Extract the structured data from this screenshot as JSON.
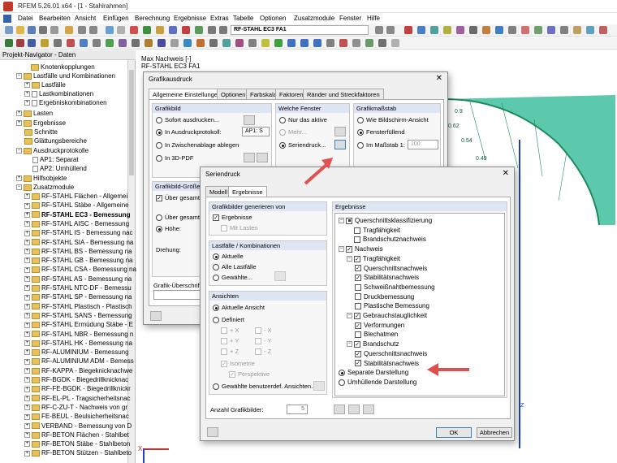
{
  "window": {
    "title": "RFEM 5.26.01 x64 - [1 - Stahlrahmen]"
  },
  "menu": [
    "Datei",
    "Bearbeiten",
    "Ansicht",
    "Einfügen",
    "Berechnung",
    "Ergebnisse",
    "Extras",
    "Tabelle",
    "Optionen",
    "Zusatzmodule",
    "Fenster",
    "Hilfe"
  ],
  "toolbar": {
    "module_combo": "RF-STAHL EC3 FA1"
  },
  "navigator": {
    "title": "Projekt-Navigator - Daten",
    "items": [
      "Knotenkopplungen",
      "Lastfälle und Kombinationen",
      "Lastfälle",
      "Lastkombinationen",
      "Ergebniskombinationen",
      "Lasten",
      "Ergebnisse",
      "Schnitte",
      "Glättungsbereiche",
      "Ausdruckprotokolle",
      "AP1: Separat",
      "AP2: Umhüllend",
      "Hilfsobjekte",
      "Zusatzmodule",
      "RF-STAHL Flächen - Allgemei",
      "RF-STAHL Stäbe - Allgemeine",
      "RF-STAHL EC3 - Bemessung",
      "RF-STAHL AISC - Bemessung",
      "RF-STAHL IS - Bemessung nac",
      "RF-STAHL SIA - Bemessung na",
      "RF-STAHL BS - Bemessung na",
      "RF-STAHL GB - Bemessung na",
      "RF-STAHL CSA - Bemessung na",
      "RF-STAHL AS - Bemessung na",
      "RF-STAHL NTC-DF - Bemessu",
      "RF-STAHL SP - Bemessung na",
      "RF-STAHL Plastisch - Plastisch",
      "RF-STAHL SANS - Bemessung",
      "RF-STAHL Ermüdung Stäbe - E",
      "RF-STAHL NBR - Bemessung n",
      "RF-STAHL HK - Bemessung na",
      "RF-ALUMINIUM - Bemessung",
      "RF-ALUMINIUM ADM - Bemess",
      "RF-KAPPA - Biegeknicknachwe",
      "RF-BGDK - Biegedrillknicknac",
      "RF-FE-BGDK - Biegedrillknickr",
      "RF-EL-PL - Tragsicherheitsnac",
      "RF-C-ZU-T - Nachweis von gr",
      "FE-BEUL - Beulsicherheitsnac",
      "VERBAND - Bemessung von D",
      "RF-BETON Flächen - Stahlbet",
      "RF-BETON Stäbe - Stahlbeton",
      "RF-BETON Stützen - Stahlbeto"
    ]
  },
  "canvas": {
    "line1": "Max Nachweis [-]",
    "line2": "RF-STAHL EC3 FA1",
    "axis_x": "X",
    "axis_z": "Z",
    "values": [
      "0.54",
      "0.49",
      "0.62",
      "0.9"
    ]
  },
  "grafikausdruck": {
    "title": "Grafikausdruck",
    "tabs": [
      "Allgemeine Einstellungen",
      "Optionen",
      "Farbskala",
      "Faktoren",
      "Ränder und Streckfaktoren"
    ],
    "grafikbild": {
      "header": "Grafikbild",
      "opts": [
        "Sofort ausdrucken...",
        "In Ausdruckprotokoll:",
        "In Zwischenablage ablegen",
        "In 3D-PDF"
      ],
      "protocol": "AP1: S"
    },
    "welche": {
      "header": "Welche Fenster",
      "opts": [
        "Nur das aktive",
        "Mehr...",
        "Seriendruck..."
      ]
    },
    "massstab": {
      "header": "Grafikmaßstab",
      "opts": [
        "Wie Bildschirm-Ansicht",
        "Fensterfüllend",
        "Im Maßstab 1:"
      ],
      "scale": "100"
    },
    "size": {
      "header": "Grafikbild-Größe u",
      "check": "Über gesamte S",
      "opt1": "Über gesamte S",
      "opt2": "Höhe:",
      "rot": "Drehung:"
    },
    "caption": "Grafik-Überschrift"
  },
  "seriendruck": {
    "title": "Seriendruck",
    "tabs": [
      "Modell",
      "Ergebnisse"
    ],
    "generate": {
      "header": "Grafikbilder generieren von",
      "ergebnisse": "Ergebnisse",
      "mit_lasten": "Mit Lasten"
    },
    "lastfaelle": {
      "header": "Lastfälle / Kombinationen",
      "opts": [
        "Aktuelle",
        "Alle Lastfälle",
        "Gewählte..."
      ]
    },
    "ansichten": {
      "header": "Ansichten",
      "aktuelle": "Aktuelle Ansicht",
      "definiert": "Definiert",
      "axes_left": [
        "+ X",
        "+ Y",
        "+ Z"
      ],
      "axes_right": [
        "- X",
        "- Y",
        "- Z"
      ],
      "isometrie": "Isometrie",
      "perspektive": "Perspektive",
      "benutzer": "Gewählte benutzerdef. Ansichten..."
    },
    "anzahl_label": "Anzahl Grafikbilder:",
    "anzahl_value": "5",
    "ergebnisse": {
      "header": "Ergebnisse",
      "tree": [
        {
          "t": "Querschnittsklassifizierung",
          "lv": 0,
          "c": "box"
        },
        {
          "t": "Tragfähigkeit",
          "lv": 1,
          "c": "empty"
        },
        {
          "t": "Brandschutznachweis",
          "lv": 1,
          "c": "empty"
        },
        {
          "t": "Nachweis",
          "lv": 0,
          "c": "check"
        },
        {
          "t": "Tragfähigkeit",
          "lv": 1,
          "c": "check"
        },
        {
          "t": "Querschnittsnachweis",
          "lv": 2,
          "c": "check"
        },
        {
          "t": "Stabilitätsnachweis",
          "lv": 2,
          "c": "check"
        },
        {
          "t": "Schweißnahtbemessung",
          "lv": 2,
          "c": "empty"
        },
        {
          "t": "Druckbemessung",
          "lv": 2,
          "c": "empty"
        },
        {
          "t": "Plastische Bemessung",
          "lv": 2,
          "c": "empty"
        },
        {
          "t": "Gebrauchstauglichkeit",
          "lv": 1,
          "c": "check"
        },
        {
          "t": "Verformungen",
          "lv": 2,
          "c": "check"
        },
        {
          "t": "Blechatmen",
          "lv": 2,
          "c": "empty"
        },
        {
          "t": "Brandschutz",
          "lv": 1,
          "c": "check"
        },
        {
          "t": "Querschnittsnachweis",
          "lv": 2,
          "c": "check"
        },
        {
          "t": "Stabilitätsnachweis",
          "lv": 2,
          "c": "check"
        }
      ],
      "radio1": "Separate Darstellung",
      "radio2": "Umhüllende Darstellung"
    },
    "ok": "OK",
    "cancel": "Abbrechen"
  }
}
